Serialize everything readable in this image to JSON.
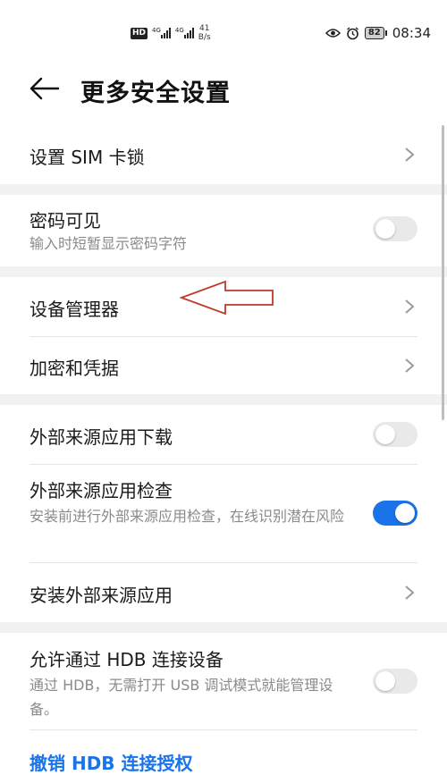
{
  "status_bar": {
    "hd_badge": "HD",
    "net1": "4G",
    "net2": "4G",
    "speed_value": "41",
    "speed_unit": "B/s",
    "battery": "82",
    "time": "08:34",
    "icons": [
      "eye-icon",
      "alarm-icon"
    ]
  },
  "header": {
    "title": "更多安全设置",
    "back_icon": "back-arrow-icon"
  },
  "items": {
    "sim_lock": {
      "label": "设置 SIM 卡锁"
    },
    "password_visible": {
      "label": "密码可见",
      "sub": "输入时短暂显示密码字符",
      "toggle": false
    },
    "device_manager": {
      "label": "设备管理器"
    },
    "encryption": {
      "label": "加密和凭据"
    },
    "external_download": {
      "label": "外部来源应用下载",
      "toggle": false
    },
    "external_check": {
      "label": "外部来源应用检查",
      "sub": "安装前进行外部来源应用检查，在线识别潜在风险",
      "toggle": true
    },
    "install_external": {
      "label": "安装外部来源应用"
    },
    "hdb": {
      "label": "允许通过 HDB 连接设备",
      "sub": "通过 HDB，无需打开 USB 调试模式就能管理设备。",
      "toggle": false
    },
    "revoke_hdb": {
      "label": "撤销 HDB 连接授权"
    }
  },
  "colors": {
    "accent": "#1a73e8",
    "toggle_off": "#e9e9e9",
    "annotation_arrow": "#c0392b",
    "section_gap": "#f1f1f1"
  }
}
